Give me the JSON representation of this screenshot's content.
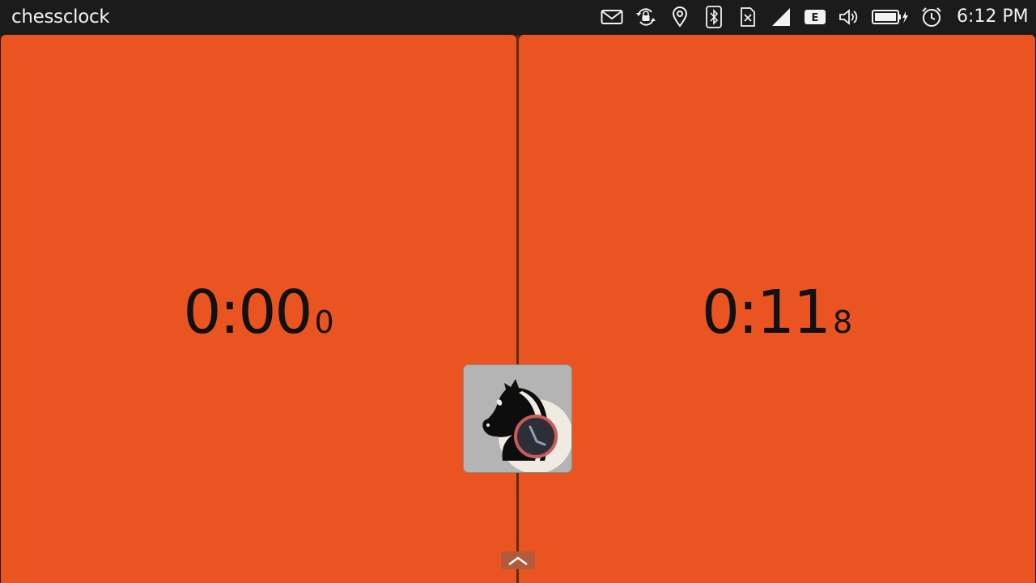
{
  "statusbar": {
    "app_title": "chessclock",
    "time": "6:12 PM",
    "network_type_badge": "E",
    "indicators": [
      "mail-icon",
      "rotation-lock-icon",
      "location-icon",
      "bluetooth-icon",
      "no-sim-icon",
      "signal-icon",
      "network-type-icon",
      "volume-icon",
      "battery-charging-icon",
      "alarm-icon"
    ]
  },
  "clock": {
    "left": {
      "main": "0:00",
      "tenths": "0"
    },
    "right": {
      "main": "0:11",
      "tenths": "8"
    }
  },
  "center_button": {
    "icon": "chess-knight-clock-icon"
  },
  "bottom_edge": {
    "icon": "chevron-up-icon"
  },
  "colors": {
    "panel": "#e95420",
    "statusbar": "#1b1b1b",
    "time_text": "#111111"
  }
}
